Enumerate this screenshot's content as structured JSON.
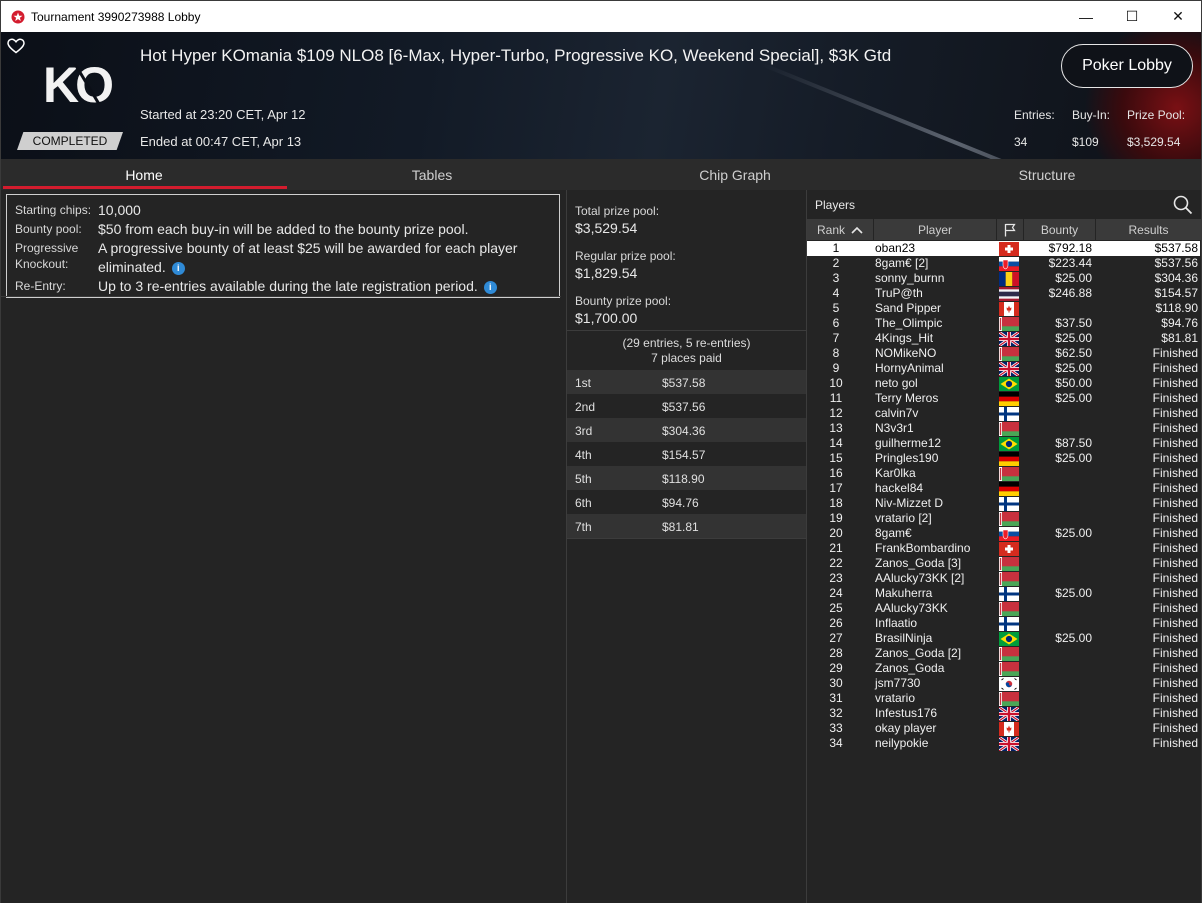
{
  "window": {
    "title": "Tournament 3990273988 Lobby",
    "controls": [
      "—",
      "☐",
      "✕"
    ]
  },
  "header": {
    "tournament_name": "Hot Hyper KOmania $109 NLO8 [6-Max, Hyper-Turbo, Progressive KO, Weekend Special], $3K Gtd",
    "logo_text": "KO",
    "status": "COMPLETED",
    "started": "Started at 23:20 CET, Apr 12",
    "ended": "Ended at 00:47 CET, Apr 13",
    "lobby_button": "Poker Lobby",
    "entries_label": "Entries:",
    "entries_value": "34",
    "buyin_label": "Buy-In:",
    "buyin_value": "$109",
    "prizepool_label": "Prize Pool:",
    "prizepool_value": "$3,529.54",
    "accent_color": "#d31c2e"
  },
  "tabs": [
    "Home",
    "Tables",
    "Chip Graph",
    "Structure"
  ],
  "info": {
    "starting_chips_label": "Starting chips:",
    "starting_chips_value": "10,000",
    "bounty_pool_label": "Bounty pool:",
    "bounty_pool_value": "$50 from each buy-in will be added to the bounty prize pool.",
    "pko_label_1": "Progressive",
    "pko_label_2": "Knockout:",
    "pko_value_1": "A progressive bounty of at least $25 will be awarded for each player",
    "pko_value_2": "eliminated.",
    "reentry_label": "Re-Entry:",
    "reentry_value": "Up to 3 re-entries available during the late registration period."
  },
  "prizes": {
    "total_label": "Total prize pool:",
    "total_value": "$3,529.54",
    "regular_label": "Regular prize pool:",
    "regular_value": "$1,829.54",
    "bounty_label": "Bounty prize pool:",
    "bounty_value": "$1,700.00",
    "entries_note": "(29 entries, 5 re-entries)",
    "places_paid": "7 places paid",
    "payouts": [
      {
        "place": "1st",
        "amount": "$537.58"
      },
      {
        "place": "2nd",
        "amount": "$537.56"
      },
      {
        "place": "3rd",
        "amount": "$304.36"
      },
      {
        "place": "4th",
        "amount": "$154.57"
      },
      {
        "place": "5th",
        "amount": "$118.90"
      },
      {
        "place": "6th",
        "amount": "$94.76"
      },
      {
        "place": "7th",
        "amount": "$81.81"
      }
    ]
  },
  "players": {
    "title": "Players",
    "columns": {
      "rank": "Rank",
      "player": "Player",
      "bounty": "Bounty",
      "results": "Results"
    },
    "rows": [
      {
        "rank": "1",
        "name": "oban23",
        "flag": "ch",
        "bounty": "$792.18",
        "result": "$537.58"
      },
      {
        "rank": "2",
        "name": "8gam€ [2]",
        "flag": "sk",
        "bounty": "$223.44",
        "result": "$537.56"
      },
      {
        "rank": "3",
        "name": "sonny_burnn",
        "flag": "ro",
        "bounty": "$25.00",
        "result": "$304.36"
      },
      {
        "rank": "4",
        "name": "TruP@th",
        "flag": "th",
        "bounty": "$246.88",
        "result": "$154.57"
      },
      {
        "rank": "5",
        "name": "Sand Pipper",
        "flag": "ca",
        "bounty": "",
        "result": "$118.90"
      },
      {
        "rank": "6",
        "name": "The_Olimpic",
        "flag": "by",
        "bounty": "$37.50",
        "result": "$94.76"
      },
      {
        "rank": "7",
        "name": "4Kings_Hit",
        "flag": "gb",
        "bounty": "$25.00",
        "result": "$81.81"
      },
      {
        "rank": "8",
        "name": "NOMikeNO",
        "flag": "by",
        "bounty": "$62.50",
        "result": "Finished"
      },
      {
        "rank": "9",
        "name": "HornyAnimal",
        "flag": "gb",
        "bounty": "$25.00",
        "result": "Finished"
      },
      {
        "rank": "10",
        "name": "neto gol",
        "flag": "br",
        "bounty": "$50.00",
        "result": "Finished"
      },
      {
        "rank": "11",
        "name": "Terry Meros",
        "flag": "de",
        "bounty": "$25.00",
        "result": "Finished"
      },
      {
        "rank": "12",
        "name": "calvin7v",
        "flag": "fi",
        "bounty": "",
        "result": "Finished"
      },
      {
        "rank": "13",
        "name": "N3v3r1",
        "flag": "by",
        "bounty": "",
        "result": "Finished"
      },
      {
        "rank": "14",
        "name": "guilherme12",
        "flag": "br",
        "bounty": "$87.50",
        "result": "Finished"
      },
      {
        "rank": "15",
        "name": "Pringles190",
        "flag": "de",
        "bounty": "$25.00",
        "result": "Finished"
      },
      {
        "rank": "16",
        "name": "Kar0lka",
        "flag": "by",
        "bounty": "",
        "result": "Finished"
      },
      {
        "rank": "17",
        "name": "hackel84",
        "flag": "de",
        "bounty": "",
        "result": "Finished"
      },
      {
        "rank": "18",
        "name": "Niv-Mizzet D",
        "flag": "fi",
        "bounty": "",
        "result": "Finished"
      },
      {
        "rank": "19",
        "name": "vratario [2]",
        "flag": "by",
        "bounty": "",
        "result": "Finished"
      },
      {
        "rank": "20",
        "name": "8gam€",
        "flag": "sk",
        "bounty": "$25.00",
        "result": "Finished"
      },
      {
        "rank": "21",
        "name": "FrankBombardino",
        "flag": "ch",
        "bounty": "",
        "result": "Finished"
      },
      {
        "rank": "22",
        "name": "Zanos_Goda [3]",
        "flag": "by",
        "bounty": "",
        "result": "Finished"
      },
      {
        "rank": "23",
        "name": "AAlucky73KK [2]",
        "flag": "by",
        "bounty": "",
        "result": "Finished"
      },
      {
        "rank": "24",
        "name": "Makuherra",
        "flag": "fi",
        "bounty": "$25.00",
        "result": "Finished"
      },
      {
        "rank": "25",
        "name": "AAlucky73KK",
        "flag": "by",
        "bounty": "",
        "result": "Finished"
      },
      {
        "rank": "26",
        "name": "Inflaatio",
        "flag": "fi",
        "bounty": "",
        "result": "Finished"
      },
      {
        "rank": "27",
        "name": "BrasilNinja",
        "flag": "br",
        "bounty": "$25.00",
        "result": "Finished"
      },
      {
        "rank": "28",
        "name": "Zanos_Goda [2]",
        "flag": "by",
        "bounty": "",
        "result": "Finished"
      },
      {
        "rank": "29",
        "name": "Zanos_Goda",
        "flag": "by",
        "bounty": "",
        "result": "Finished"
      },
      {
        "rank": "30",
        "name": "jsm7730",
        "flag": "kr",
        "bounty": "",
        "result": "Finished"
      },
      {
        "rank": "31",
        "name": "vratario",
        "flag": "by",
        "bounty": "",
        "result": "Finished"
      },
      {
        "rank": "32",
        "name": "Infestus176",
        "flag": "gb",
        "bounty": "",
        "result": "Finished"
      },
      {
        "rank": "33",
        "name": "okay player",
        "flag": "ca",
        "bounty": "",
        "result": "Finished"
      },
      {
        "rank": "34",
        "name": "neilypokie",
        "flag": "gb",
        "bounty": "",
        "result": "Finished"
      }
    ]
  }
}
